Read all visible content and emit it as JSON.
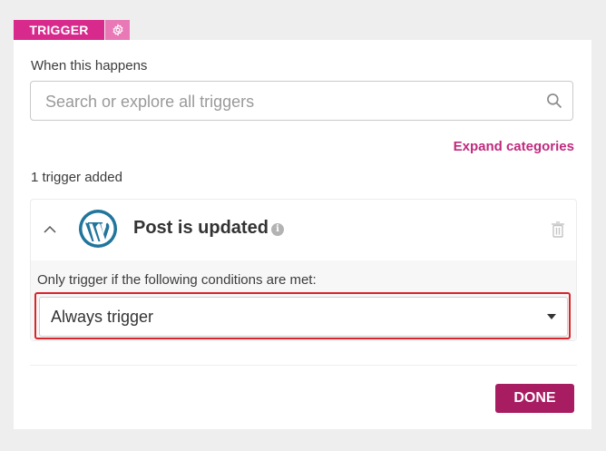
{
  "tab": {
    "label": "TRIGGER",
    "settings_icon": "gear-icon",
    "color": "#d8298c",
    "settings_color": "#e879b6"
  },
  "card": {
    "when_label": "When this happens",
    "search": {
      "placeholder": "Search or explore all triggers",
      "value": "",
      "icon": "search-icon"
    },
    "expand_link": "Expand categories",
    "added_label": "1 trigger added",
    "trigger_item": {
      "collapse_icon": "chevron-up-icon",
      "app_icon": "wordpress-logo",
      "title": "Post is updated",
      "info_icon": "info-icon",
      "delete_icon": "trash-icon",
      "condition_label": "Only trigger if the following conditions are met:",
      "condition_select": {
        "selected": "Always trigger"
      }
    },
    "done_label": "DONE"
  },
  "colors": {
    "accent_link": "#c02a7e",
    "done_button": "#a81d62",
    "highlight_border": "#d9242a",
    "wordpress_blue": "#21759b"
  }
}
